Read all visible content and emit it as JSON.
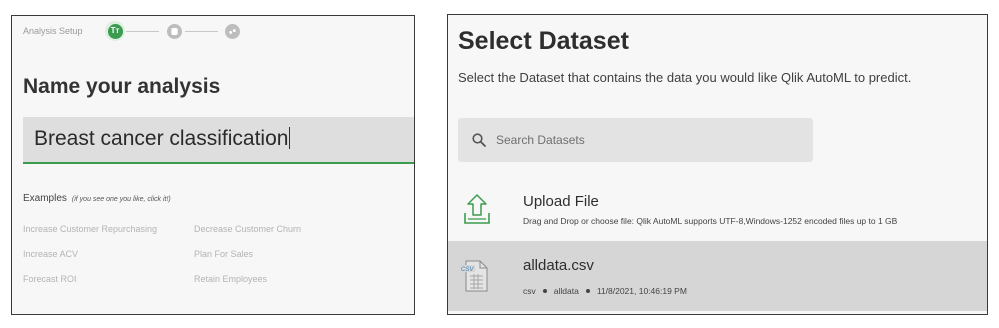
{
  "setup": {
    "label": "Analysis Setup",
    "steps": [
      {
        "icon": "text-icon",
        "glyph": "Tт",
        "state": "active"
      },
      {
        "icon": "database-icon",
        "glyph": "≡",
        "state": "inactive"
      },
      {
        "icon": "target-icon",
        "glyph": "◦",
        "state": "inactive"
      }
    ],
    "accent_color": "#3b9b4f"
  },
  "analysis": {
    "heading": "Name your analysis",
    "name_value": "Breast cancer classification",
    "examples_label": "Examples",
    "examples_hint": "(if you see one you like, click it!)",
    "examples": [
      "Increase Customer Repurchasing",
      "Decrease Customer Churn",
      "Increase ACV",
      "Plan For Sales",
      "Forecast ROI",
      "Retain Employees"
    ]
  },
  "dataset": {
    "title": "Select Dataset",
    "subtitle": "Select the Dataset that contains the data you would like Qlik AutoML to predict.",
    "search_placeholder": "Search Datasets",
    "upload": {
      "title": "Upload File",
      "description": "Drag and Drop or choose file: Qlik AutoML supports UTF-8,Windows-1252 encoded files up to 1 GB"
    },
    "files": [
      {
        "name": "alldata.csv",
        "type": "csv",
        "space": "alldata",
        "modified": "11/8/2021, 10:46:19 PM",
        "icon_badge": "CSV"
      }
    ]
  }
}
